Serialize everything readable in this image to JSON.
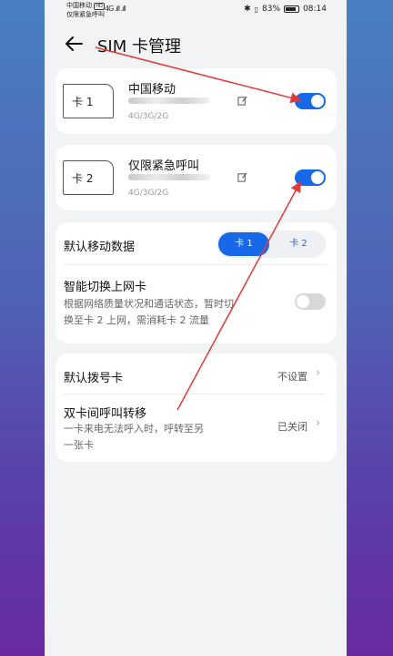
{
  "status_bar": {
    "carrier_line1": "中国移动",
    "carrier_hd": "HD",
    "carrier_line2": "仅限紧急呼叫",
    "signal_text": "4G .ıll .ıll",
    "battery_percent": "83%",
    "time": "08:14"
  },
  "header": {
    "title": "SIM 卡管理"
  },
  "sim1": {
    "label": "卡 1",
    "carrier": "中国移动",
    "network": "4G/3G/2G",
    "enabled": true
  },
  "sim2": {
    "label": "卡 2",
    "carrier": "仅限紧急呼叫",
    "network": "4G/3G/2G",
    "enabled": true
  },
  "data_settings": {
    "default_data_label": "默认移动数据",
    "card1_option": "卡 1",
    "card2_option": "卡 2",
    "selected": "卡 1",
    "smart_switch_label": "智能切换上网卡",
    "smart_switch_desc_line1": "根据网络质量状况和通话状态，暂时切",
    "smart_switch_desc_line2": "换至卡 2 上网，需消耗卡 2 流量",
    "smart_switch_enabled": false
  },
  "call_settings": {
    "default_dial_label": "默认拨号卡",
    "default_dial_value": "不设置",
    "forward_label": "双卡间呼叫转移",
    "forward_desc_line1": "一卡来电无法呼入时，呼转至另",
    "forward_desc_line2": "一张卡",
    "forward_value": "已关闭"
  },
  "icons": {
    "back": "back-arrow-icon",
    "edit": "edit-icon",
    "chevron": "chevron-right-icon"
  },
  "colors": {
    "accent": "#1868ea",
    "annotation": "#e53a3a"
  }
}
